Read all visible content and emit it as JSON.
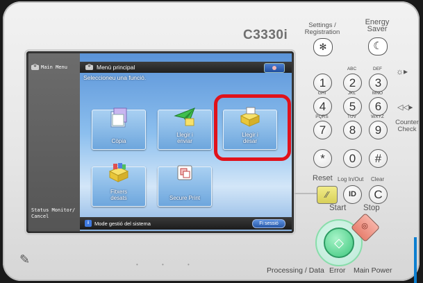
{
  "device": {
    "model": "C3330i"
  },
  "screen": {
    "sidebar": {
      "main_menu": "Main Menu",
      "status_monitor_line1": "Status Monitor/",
      "status_monitor_line2": "Cancel"
    },
    "topbar": {
      "title": "Menú principal"
    },
    "subtitle": "Seleccioneu una funció.",
    "tiles": [
      {
        "label": "Còpia",
        "icon": "copy-icon"
      },
      {
        "label_line1": "Llegir i",
        "label_line2": "enviar",
        "icon": "scan-send-icon"
      },
      {
        "label_line1": "Llegir i",
        "label_line2": "desar",
        "icon": "scan-store-icon"
      },
      {
        "label_line1": "Fitxers",
        "label_line2": "desats",
        "icon": "stored-files-icon"
      },
      {
        "label": "Secure Print",
        "icon": "secure-print-icon"
      }
    ],
    "bottombar": {
      "mode_text": "Mode gestió del sistema",
      "logout": "Fi sessió"
    },
    "highlight_color": "#e0121b"
  },
  "hardware": {
    "settings_line1": "Settings /",
    "settings_line2": "Registration",
    "energy_line1": "Energy",
    "energy_line2": "Saver",
    "counter_line1": "Counter",
    "counter_line2": "Check",
    "keys": [
      "1",
      "2",
      "3",
      "4",
      "5",
      "6",
      "7",
      "8",
      "9",
      "*",
      "0",
      "#"
    ],
    "key_sub": {
      "2": "ABC",
      "3": "DEF",
      "4": "GHI",
      "5": "JKL",
      "6": "MNO",
      "7": "PQRS",
      "8": "TUV",
      "9": "WXYZ"
    },
    "reset": "Reset",
    "login_out": "Log In/Out",
    "id_key": "ID",
    "clear": "Clear",
    "clear_key": "C",
    "start": "Start",
    "stop": "Stop",
    "footer": {
      "processing": "Processing / Data",
      "error": "Error",
      "main_power": "Main Power"
    }
  }
}
